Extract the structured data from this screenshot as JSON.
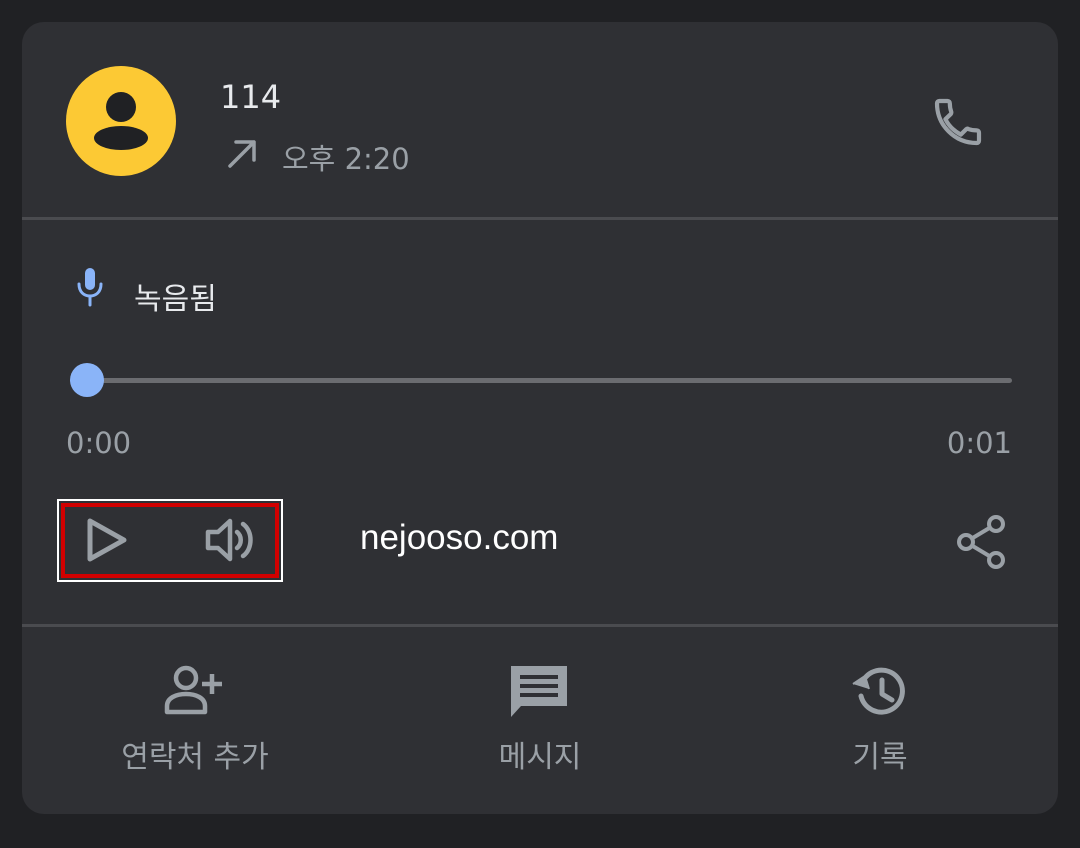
{
  "call": {
    "caller": "114",
    "direction": "outgoing",
    "time": "오후 2:20"
  },
  "recording": {
    "label": "녹음됨",
    "position_fraction": 0.0,
    "current_time": "0:00",
    "duration": "0:01"
  },
  "watermark": "nejooso.com",
  "actions": [
    {
      "label": "연락처 추가",
      "icon": "add-contact-icon"
    },
    {
      "label": "메시지",
      "icon": "message-icon"
    },
    {
      "label": "기록",
      "icon": "history-icon"
    }
  ],
  "colors": {
    "background": "#202124",
    "card": "#2f3034",
    "avatar": "#fcc934",
    "accent": "#8ab4f8",
    "icon": "#9aa0a6",
    "text": "#e8eaed",
    "highlight": "#d10000"
  }
}
